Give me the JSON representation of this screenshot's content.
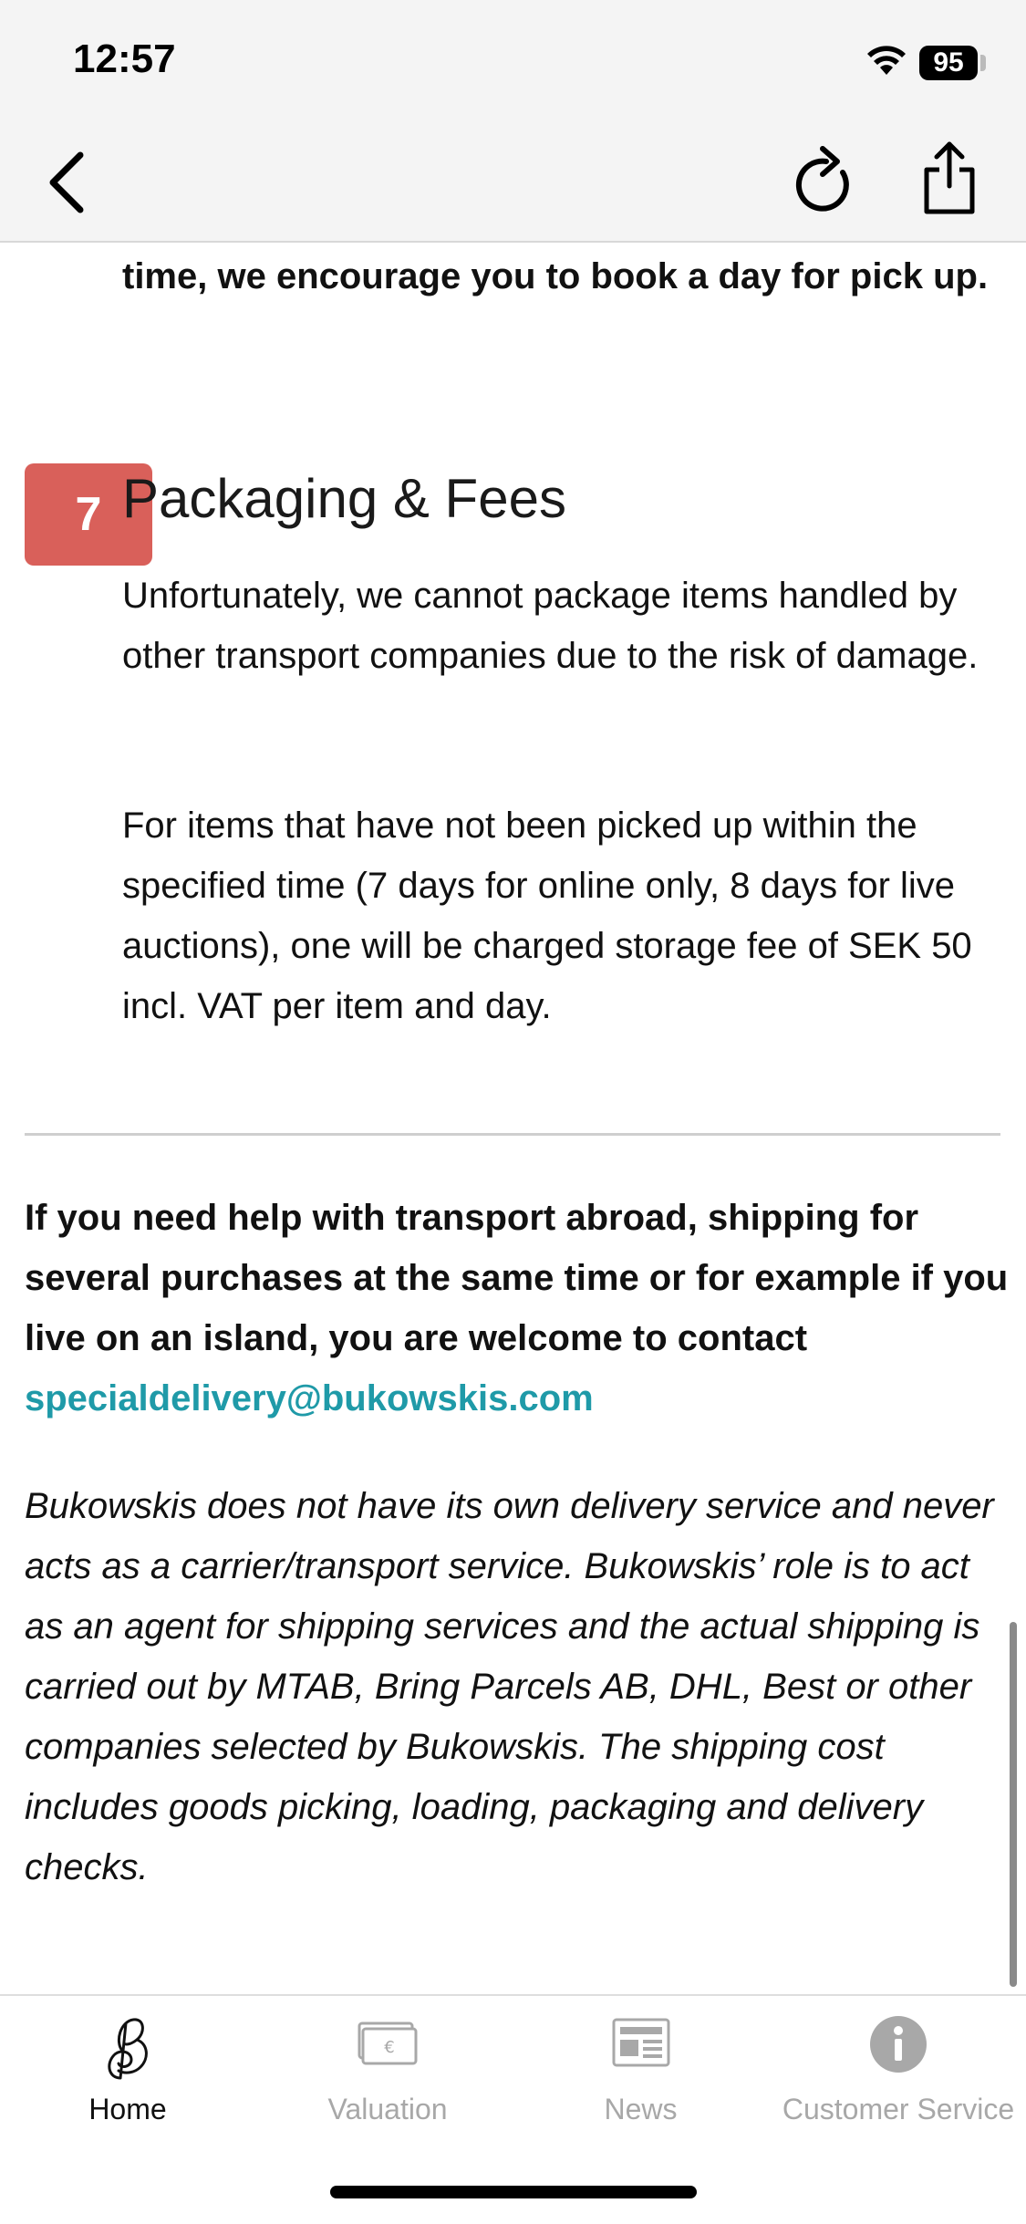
{
  "status_bar": {
    "time": "12:57",
    "battery": "95"
  },
  "nav": {
    "back_label": "Back",
    "reload_label": "Reload",
    "share_label": "Share"
  },
  "content": {
    "lead_text": "time, we encourage you to book a day for pick up.",
    "step_number": "7",
    "section_title": "Packaging & Fees",
    "paragraph_1": "Unfortunately, we cannot package items handled by other transport companies due to the risk of damage.",
    "paragraph_2": "For items that have not been picked up within the specified time (7 days for online only, 8 days for live auctions), one will be charged storage fee of SEK 50 incl. VAT per item and day.",
    "help_text": "If you need help with transport abroad, shipping for several purchases at the same time or for example if you live on an island, you are welcome to contact",
    "help_email": "specialdelivery@bukowskis.com",
    "disclaimer": "Bukowskis does not have its own delivery service and never acts as a carrier/transport service. Bukowskis’ role is to act as an agent for shipping services and the actual shipping is carried out by MTAB, Bring Parcels AB, DHL, Best or other companies selected by Bukowskis. The shipping cost includes goods picking, loading, packaging and delivery checks."
  },
  "tabs": [
    {
      "label": "Home",
      "icon": "bukowskis-logo-icon",
      "active": true
    },
    {
      "label": "Valuation",
      "icon": "valuation-icon",
      "active": false
    },
    {
      "label": "News",
      "icon": "news-icon",
      "active": false
    },
    {
      "label": "Customer Service",
      "icon": "info-icon",
      "active": false
    }
  ],
  "colors": {
    "badge": "#d9605a",
    "link": "#1f9aa8",
    "inactive_tab": "#a8a8a8"
  }
}
